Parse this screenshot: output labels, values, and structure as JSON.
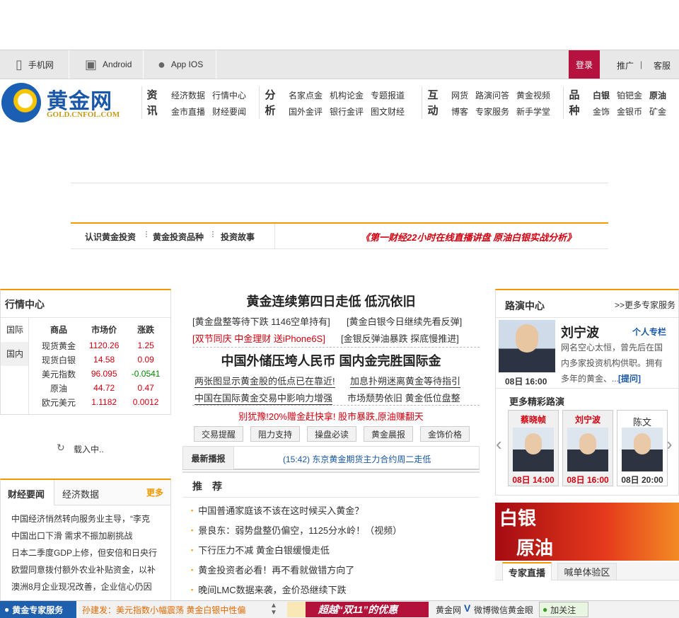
{
  "topbar": {
    "items": [
      {
        "label": "手机网",
        "icon": "phone-icon"
      },
      {
        "label": "Android",
        "icon": "android-icon"
      },
      {
        "label": "App IOS",
        "icon": "apple-icon"
      }
    ],
    "login": "登录",
    "promo": "推广",
    "sep": "|",
    "service": "客服"
  },
  "header": {
    "logo_text": "黄金网",
    "logo_sub": "GOLD.CNFOL.COM",
    "groups": [
      {
        "cat1": "资",
        "cat2": "讯",
        "links": [
          "经济数据",
          "行情中心",
          "金市直播",
          "财经要闻"
        ]
      },
      {
        "cat1": "分",
        "cat2": "析",
        "links": [
          "名家点金",
          "机构论金",
          "专题报道",
          "国外金评",
          "银行金评",
          "图文财经"
        ]
      },
      {
        "cat1": "互",
        "cat2": "动",
        "links": [
          "网货",
          "路演问答",
          "黄金视频",
          "博客",
          "专家服务",
          "新手学堂"
        ]
      },
      {
        "cat1": "品",
        "cat2": "种",
        "links": [
          "白银",
          "铂钯金",
          "原油",
          "金饰",
          "金银币",
          "矿金"
        ]
      }
    ]
  },
  "subnav": {
    "links": [
      "认识黄金投资",
      "黄金投资品种",
      "投资故事"
    ],
    "promo": "《第一财经22小时在线直播讲盘  原油白银实战分析》"
  },
  "market": {
    "title": "行情中心",
    "tabs": [
      "国际",
      "国内"
    ],
    "headers": [
      "商品",
      "市场价",
      "涨跌"
    ],
    "rows": [
      {
        "name": "现货黄金",
        "price": "1120.26",
        "change": "1.25"
      },
      {
        "name": "现货白银",
        "price": "14.58",
        "change": "0.09"
      },
      {
        "name": "美元指数",
        "price": "96.095",
        "change": "-0.0541"
      },
      {
        "name": "原油",
        "price": "44.72",
        "change": "0.47"
      },
      {
        "name": "欧元美元",
        "price": "1.1182",
        "change": "0.0012"
      }
    ],
    "loading": "载入中.."
  },
  "finance": {
    "tabs": [
      "财经要闻",
      "经济数据"
    ],
    "more": "更多",
    "items": [
      "中国经济悄然转向服务业主导，“李克",
      "中国出口下滑 需求不振加剧挑战",
      "日本二季度GDP上修，但安倍和日央行",
      "欧盟同意拨付额外农业补贴资金，以补",
      "澳洲8月企业现况改善，企业信心仍因"
    ]
  },
  "center": {
    "headline1": "黄金连续第四日走低 低沉依旧",
    "sub1a": "[黄金盘整等待下跌 1146空单持有]",
    "sub1b": "[黄金白银今日继续先看反弹]",
    "sub2a": "[双节同庆 中金理财 送iPhone6S]",
    "sub2b": "[金银反弹油暴跌 探底慢推进]",
    "headline2": "中国外储压垮人民币 国内金完胜国际金",
    "line3a": "两张图显示黄金股的低点已在靠近!",
    "line3b": "加息扑朔迷离黄金等待指引",
    "line4a": "中国在国际黄金交易中影响力增强",
    "line4b": "市场颓势依旧 黄金低位盘整",
    "line5": "别犹豫!20%赠金赶快拿! 股市暴跌,原油赚翻天",
    "buttons": [
      "交易提醒",
      "阻力支持",
      "操盘必读",
      "黄金晨报",
      "金饰价格"
    ],
    "latest_label": "最新播报",
    "latest_text": "(15:42) 东京黄金期货主力合约周二走低",
    "rec_title": "推　荐",
    "rec_items": [
      "中国普通家庭该不该在这时候买入黄金？",
      "景良东：弱势盘整仍偏空，1125分水岭！（视频）",
      "下行压力不减 黄金白银缓慢走低",
      "黄金投资者必看！再不看就做错方向了",
      "晚间LMC数据来袭，金价恐继续下跌"
    ]
  },
  "roadshow": {
    "title": "路演中心",
    "more": ">>更多专家服务",
    "expert_name": "刘宁波",
    "column_link": "个人专栏",
    "intro1": "网名空心太恒，曾先后在国",
    "intro2": "内多家投资机构供职。拥有",
    "intro3": "多年的黄金、...",
    "ask": "[提问]",
    "time": "08日 16:00",
    "more_title": "更多精彩路演",
    "cards": [
      {
        "name": "蔡晓帧",
        "time": "08日 14:00"
      },
      {
        "name": "刘宁波",
        "time": "08日 16:00"
      },
      {
        "name": "陈文",
        "time": "08日 20:00"
      }
    ],
    "prev": "‹",
    "next": "›"
  },
  "banner": {
    "line1": "白银",
    "line2": "原油"
  },
  "expert": {
    "tabs": [
      "专家直播",
      "喊单体验区"
    ]
  },
  "bottombar": {
    "service": "黄金专家服务",
    "ticker": "孙建发：美元指数小幅震荡 黄金白银中性偏",
    "ad": "超越“双11”的优惠",
    "weibo_pre": "黄金网",
    "weibo": "微博微信黄金眼",
    "follow": "加关注"
  },
  "colors": {
    "accent": "#f39800",
    "brand": "#1a57a8",
    "red": "#d4000f",
    "login": "#b5123f"
  }
}
